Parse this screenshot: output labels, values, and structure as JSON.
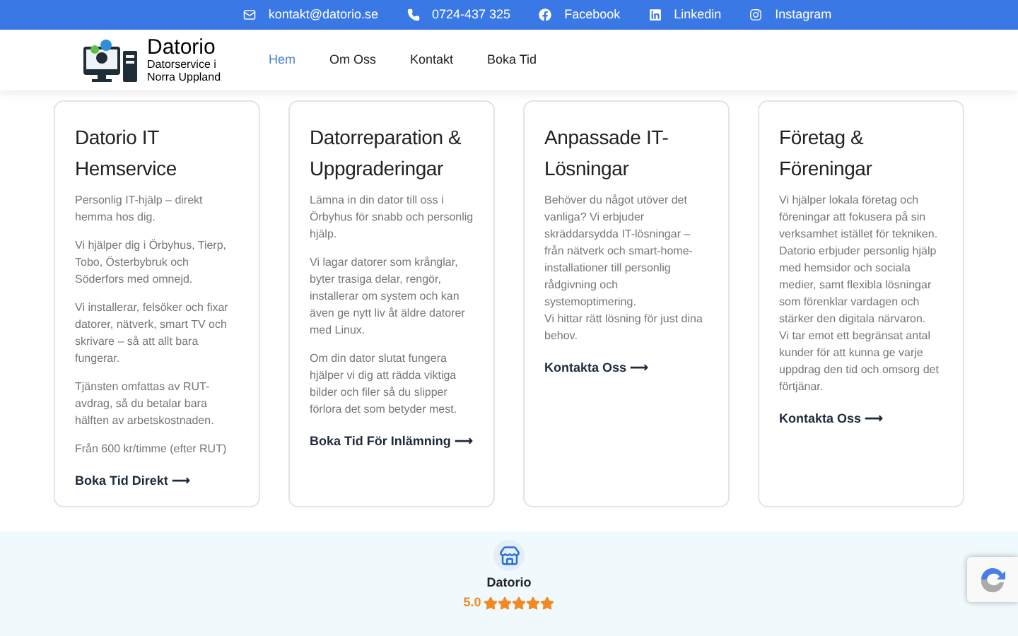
{
  "top_bar": [
    {
      "kind": "mail",
      "text": "kontakt@datorio.se"
    },
    {
      "kind": "phone",
      "text": "0724-437 325"
    },
    {
      "kind": "facebook",
      "text": "Facebook"
    },
    {
      "kind": "linkedin",
      "text": "Linkedin"
    },
    {
      "kind": "instagram",
      "text": "Instagram"
    }
  ],
  "logo": {
    "name": "Datorio",
    "tagline": "Datorservice i Norra Uppland"
  },
  "nav": [
    {
      "label": "Hem",
      "selected": true
    },
    {
      "label": "Om Oss",
      "selected": false
    },
    {
      "label": "Kontakt",
      "selected": false
    },
    {
      "label": "Boka Tid",
      "selected": false
    }
  ],
  "cards": [
    {
      "title": "Datorio IT Hemservice",
      "paragraphs": [
        [
          "Personlig IT-hjälp – direkt hemma hos dig."
        ],
        [
          "Vi hjälper dig i Örbyhus, Tierp, Tobo, Österbybruk och Söderfors med omnejd."
        ],
        [
          "Vi installerar, felsöker och fixar datorer, nätverk, smart TV och skrivare – så att allt bara fungerar."
        ],
        [
          "Tjänsten omfattas av RUT-avdrag, så du betalar bara hälften av arbetskostnaden."
        ],
        [
          "Från 600 kr/timme (efter RUT)"
        ]
      ],
      "link": "Boka Tid Direkt ⟶"
    },
    {
      "title": "Datorreparation & Uppgraderingar",
      "paragraphs": [
        [
          "Lämna in din dator till oss i Örbyhus för snabb och personlig hjälp."
        ],
        [
          "Vi lagar datorer som krånglar, byter trasiga delar, rengör, installerar om system och kan även ge nytt liv åt äldre datorer med Linux."
        ],
        [
          "Om din dator slutat fungera hjälper vi dig att rädda viktiga bilder och filer så du slipper förlora det som betyder mest."
        ]
      ],
      "link": "Boka Tid För Inlämning ⟶"
    },
    {
      "title": "Anpassade IT-Lösningar",
      "paragraphs": [
        [
          "Behöver du något utöver det vanliga? Vi erbjuder skräddarsydda IT-lösningar – från nätverk och smart-home-installationer till personlig rådgivning och systemoptimering.",
          "Vi hittar rätt lösning för just dina behov."
        ]
      ],
      "link": "Kontakta Oss ⟶"
    },
    {
      "title": "Företag & Föreningar",
      "paragraphs": [
        [
          "Vi hjälper lokala företag och föreningar att fokusera på sin verksamhet istället för tekniken. Datorio erbjuder personlig hjälp med hemsidor och sociala medier, samt flexibla lösningar som förenklar vardagen och stärker den digitala närvaron.",
          "Vi tar emot ett begränsat antal kunder för att kunna ge varje uppdrag den tid och omsorg det förtjänar."
        ]
      ],
      "link": "Kontakta Oss ⟶"
    }
  ],
  "review": {
    "name": "Datorio",
    "rating": "5.0",
    "stars": 5
  }
}
